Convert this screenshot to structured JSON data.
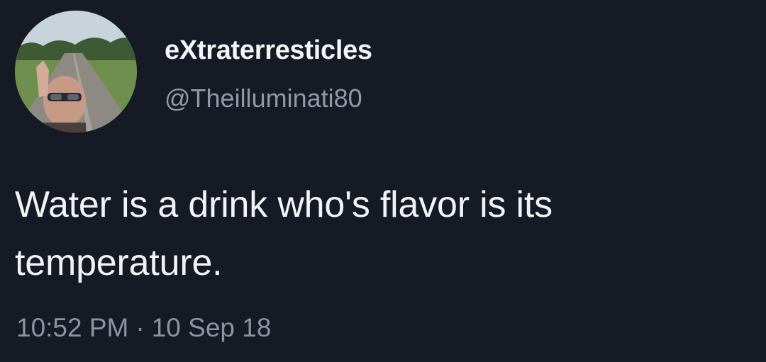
{
  "tweet": {
    "display_name": "eXtraterresticles",
    "handle": "@Theilluminati80",
    "text_line1": "Water is a drink who's flavor is its",
    "text_line2": "temperature.",
    "time": "10:52 PM",
    "separator": "·",
    "date": "10 Sep 18"
  },
  "colors": {
    "background": "#151a24",
    "name": "#f4f5f7",
    "handle": "#8f9aa6",
    "meta": "#8a95a1"
  }
}
